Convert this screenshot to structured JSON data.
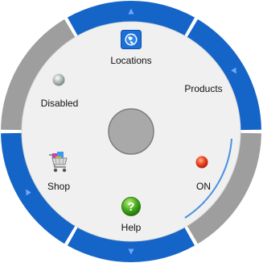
{
  "menu": {
    "items": [
      {
        "key": "locations",
        "label": "Locations",
        "icon": "globe-icon"
      },
      {
        "key": "products",
        "label": "Products",
        "icon": "none"
      },
      {
        "key": "on",
        "label": "ON",
        "icon": "red-orb-icon"
      },
      {
        "key": "help",
        "label": "Help",
        "icon": "help-icon"
      },
      {
        "key": "shop",
        "label": "Shop",
        "icon": "shopping-cart-icon"
      },
      {
        "key": "disabled",
        "label": "Disabled",
        "icon": "grey-orb-icon",
        "disabled": true
      }
    ],
    "rim_segments": [
      {
        "name": "rim-top",
        "state": "active"
      },
      {
        "name": "rim-top-right",
        "state": "active"
      },
      {
        "name": "rim-right",
        "state": "disabled"
      },
      {
        "name": "rim-bottom",
        "state": "active"
      },
      {
        "name": "rim-left",
        "state": "active"
      },
      {
        "name": "rim-top-left",
        "state": "disabled"
      }
    ],
    "center_button": {
      "icon": "center-circle-icon"
    }
  },
  "colors": {
    "active_rim": "#1565c8",
    "disabled_rim": "#9e9e9e",
    "face": "#f0f0f0",
    "center": "#a9a9a9"
  }
}
